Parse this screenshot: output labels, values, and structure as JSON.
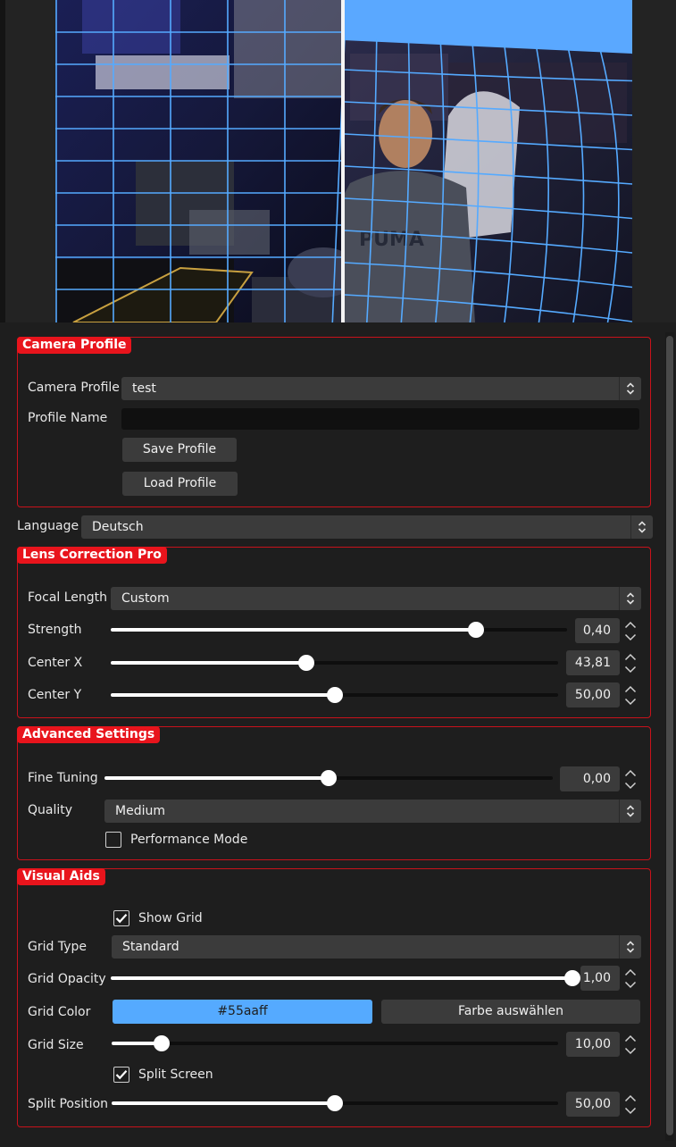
{
  "camera_profile": {
    "title": "Camera Profile",
    "profile_label": "Camera Profile",
    "profile_value": "test",
    "name_label": "Profile Name",
    "name_value": "",
    "save_button": "Save Profile",
    "load_button": "Load Profile"
  },
  "language": {
    "label": "Language",
    "value": "Deutsch"
  },
  "lens_correction": {
    "title": "Lens Correction Pro",
    "focal_label": "Focal Length",
    "focal_value": "Custom",
    "strength_label": "Strength",
    "strength_value": "0,40",
    "strength_level": 0.4,
    "center_x_label": "Center X",
    "center_x_value": "43,81",
    "center_x_level": 0.4381,
    "center_y_label": "Center Y",
    "center_y_value": "50,00",
    "center_y_level": 0.5
  },
  "advanced": {
    "title": "Advanced Settings",
    "fine_label": "Fine Tuning",
    "fine_value": "0,00",
    "fine_level": 0.0,
    "quality_label": "Quality",
    "quality_value": "Medium",
    "perf_label": "Performance Mode",
    "perf_checked": false
  },
  "visual_aids": {
    "title": "Visual Aids",
    "show_grid_label": "Show Grid",
    "show_grid_checked": true,
    "grid_type_label": "Grid Type",
    "grid_type_value": "Standard",
    "grid_opacity_label": "Grid Opacity",
    "grid_opacity_value": "1,00",
    "grid_opacity_level": 1.0,
    "grid_color_label": "Grid Color",
    "grid_color_value": "#55aaff",
    "choose_color_button": "Farbe auswählen",
    "grid_size_label": "Grid Size",
    "grid_size_value": "10,00",
    "grid_size_level": 10,
    "split_label": "Split Screen",
    "split_checked": true,
    "split_pos_label": "Split Position",
    "split_pos_value": "50,00",
    "split_pos_level": 0.5
  },
  "colors": {
    "accent_red": "#e8141c",
    "grid_blue": "#55aaff",
    "panel_bg": "#1e1e1e",
    "control_bg": "#3b3b3b"
  },
  "icons": {
    "combo": "up-down-chevron-icon",
    "spin_up": "chevron-up-icon",
    "spin_down": "chevron-down-icon",
    "check": "checkmark-icon"
  }
}
